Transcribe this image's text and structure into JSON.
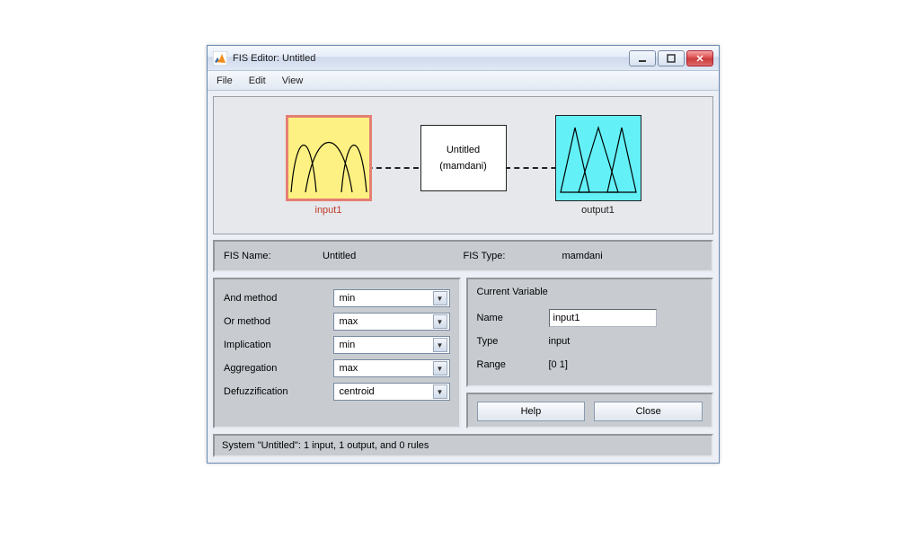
{
  "window": {
    "title": "FIS Editor: Untitled"
  },
  "menu": {
    "file": "File",
    "edit": "Edit",
    "view": "View"
  },
  "diagram": {
    "input_label": "input1",
    "rule_name": "Untitled",
    "rule_type": "(mamdani)",
    "output_label": "output1"
  },
  "info": {
    "fis_name_label": "FIS Name:",
    "fis_name_value": "Untitled",
    "fis_type_label": "FIS Type:",
    "fis_type_value": "mamdani"
  },
  "methods": {
    "and": {
      "label": "And method",
      "value": "min"
    },
    "or": {
      "label": "Or method",
      "value": "max"
    },
    "implication": {
      "label": "Implication",
      "value": "min"
    },
    "aggregation": {
      "label": "Aggregation",
      "value": "max"
    },
    "defuzz": {
      "label": "Defuzzification",
      "value": "centroid"
    }
  },
  "current": {
    "heading": "Current Variable",
    "name_label": "Name",
    "name_value": "input1",
    "type_label": "Type",
    "type_value": "input",
    "range_label": "Range",
    "range_value": "[0 1]"
  },
  "buttons": {
    "help": "Help",
    "close": "Close"
  },
  "status": "System \"Untitled\": 1 input, 1 output, and 0 rules"
}
